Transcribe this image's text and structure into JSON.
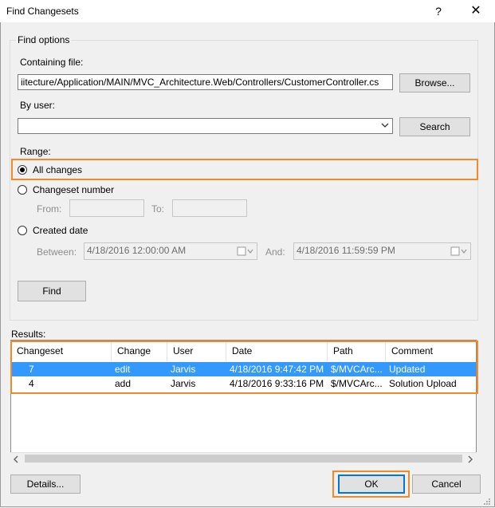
{
  "window": {
    "title": "Find Changesets",
    "help_glyph": "?",
    "close_glyph": "✕"
  },
  "find_options": {
    "legend": "Find options",
    "containing_file_label": "Containing file:",
    "containing_file_value": "iitecture/Application/MAIN/MVC_Architecture.Web/Controllers/CustomerController.cs",
    "browse_label": "Browse...",
    "by_user_label": "By user:",
    "by_user_value": "",
    "search_label": "Search",
    "range_label": "Range:",
    "range_options": {
      "all_changes": "All changes",
      "changeset_number": "Changeset number",
      "created_date": "Created date"
    },
    "selected_range": "all_changes",
    "from_label": "From:",
    "to_label": "To:",
    "from_value": "",
    "to_value": "",
    "between_label": "Between:",
    "and_label": "And:",
    "between_value": "4/18/2016 12:00:00 AM",
    "and_value": "4/18/2016 11:59:59 PM",
    "find_label": "Find"
  },
  "results": {
    "label": "Results:",
    "columns": [
      "Changeset",
      "Change",
      "User",
      "Date",
      "Path",
      "Comment"
    ],
    "rows": [
      [
        "7",
        "edit",
        "Jarvis",
        "4/18/2016 9:47:42 PM",
        "$/MVCArc...",
        "Updated"
      ],
      [
        "4",
        "add",
        "Jarvis",
        "4/18/2016 9:33:16 PM",
        "$/MVCArc...",
        "Solution Upload"
      ]
    ],
    "selected_row_color": "#3399ff"
  },
  "footer": {
    "details_label": "Details...",
    "ok_label": "OK",
    "cancel_label": "Cancel"
  },
  "colors": {
    "highlight": "#f08a2b",
    "selection": "#3399ff"
  }
}
